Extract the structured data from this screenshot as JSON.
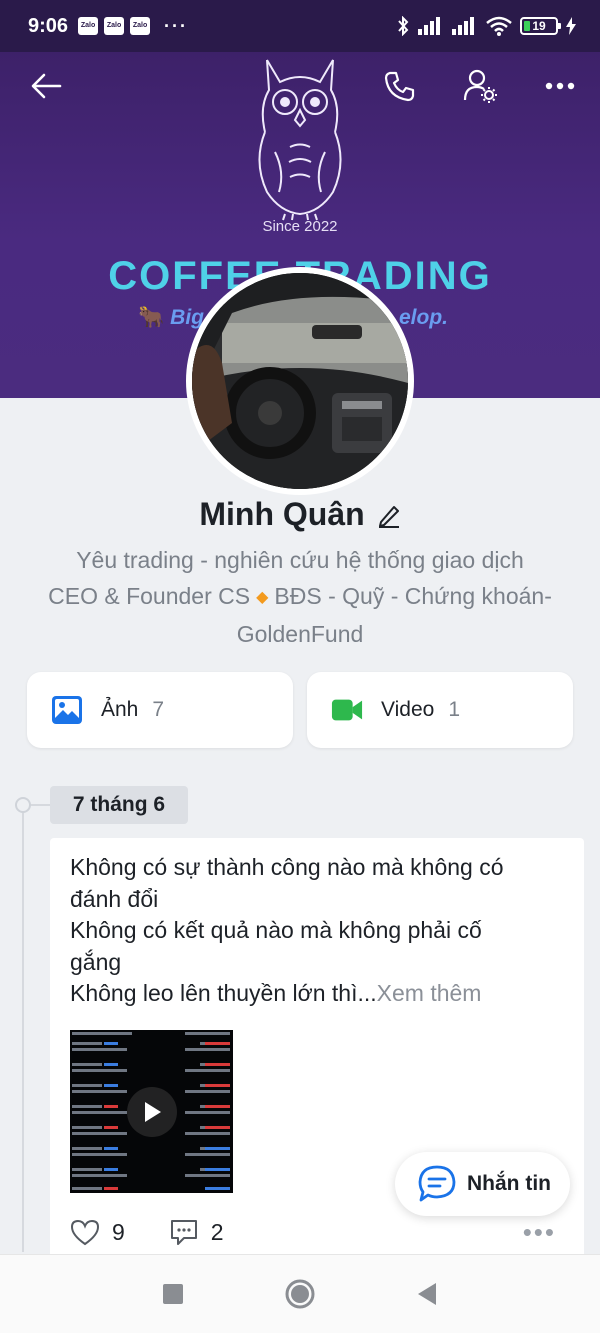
{
  "status_bar": {
    "time": "9:06",
    "notifications": [
      "Zalo",
      "Zalo",
      "Zalo"
    ],
    "overflow": "···",
    "battery_level": "19",
    "battery_fraction": 0.19
  },
  "header": {
    "back_icon": "arrow-left-icon",
    "actions": [
      {
        "icon": "phone-icon"
      },
      {
        "icon": "profile-settings-icon"
      },
      {
        "icon": "more-horizontal-icon"
      }
    ]
  },
  "cover": {
    "since": "Since 2022",
    "brand_left": "COFFEE",
    "brand_right": "TRADING",
    "tagline_left": "Big",
    "tagline_right": "elop."
  },
  "profile": {
    "name": "Minh Quân",
    "edit_icon": "pencil-icon",
    "bio_line1": "Yêu trading - nghiên cứu hệ thống giao dịch",
    "bio_line2_a": "CEO & Founder CS",
    "bio_diamond": "🔸",
    "bio_line2_b": "BĐS - Quỹ - Chứng khoán-",
    "bio_line3": "GoldenFund"
  },
  "media": {
    "photos": {
      "label": "Ảnh",
      "count": "7",
      "icon": "image-icon",
      "color": "#1a73e8"
    },
    "videos": {
      "label": "Video",
      "count": "1",
      "icon": "video-camera-icon",
      "color": "#2eb84d"
    }
  },
  "timeline": {
    "date": "7 tháng 6",
    "post": {
      "line1": "Không có sự thành công nào mà không có",
      "line2": "đánh đổi",
      "line3": "Không có kết quả nào mà không phải cố",
      "line4": "gắng",
      "line5": "Không leo lên thuyền lớn thì...",
      "see_more": "Xem thêm",
      "likes": "9",
      "comments": "2"
    }
  },
  "message_button": {
    "label": "Nhắn tin",
    "icon": "chat-bubble-icon"
  },
  "colors": {
    "cover_bg": "#3d2169",
    "accent_blue": "#1a73e8",
    "accent_green": "#2eb84d",
    "brand_cyan": "#4fd1e8"
  }
}
